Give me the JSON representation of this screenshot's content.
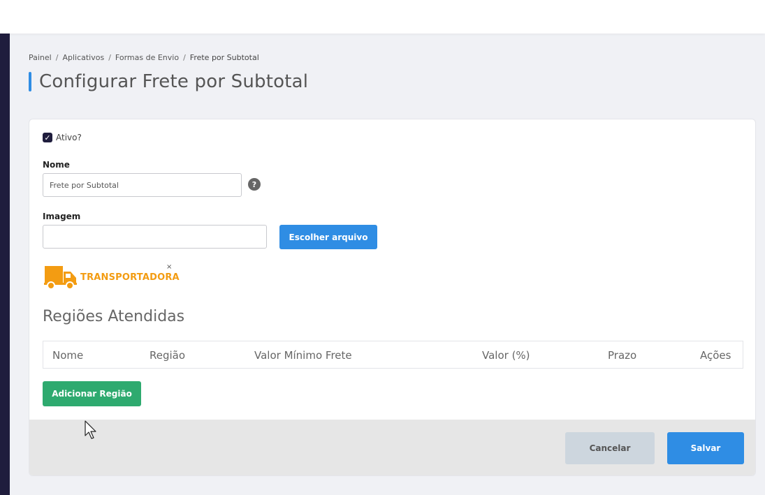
{
  "breadcrumb": {
    "items": [
      "Painel",
      "Aplicativos",
      "Formas de Envio"
    ],
    "current": "Frete por Subtotal",
    "separator": "/"
  },
  "page": {
    "title": "Configurar Frete por Subtotal"
  },
  "form": {
    "active_label": "Ativo?",
    "active_checked": true,
    "name_label": "Nome",
    "name_value": "Frete por Subtotal",
    "help_symbol": "?",
    "image_label": "Imagem",
    "image_value": "",
    "choose_file_label": "Escolher arquivo",
    "image_logo_text": "TRANSPORTADORA",
    "remove_image": "×"
  },
  "regions": {
    "title": "Regiões Atendidas",
    "columns": [
      "Nome",
      "Região",
      "Valor Mínimo Frete",
      "Valor (%)",
      "Prazo",
      "Ações"
    ],
    "add_button_label": "Adicionar Região"
  },
  "footer": {
    "cancel_label": "Cancelar",
    "save_label": "Salvar"
  },
  "colors": {
    "accent": "#2f8de4",
    "success": "#2eaa6f",
    "sidebar": "#1f1d3d",
    "logo": "#f39c12"
  }
}
